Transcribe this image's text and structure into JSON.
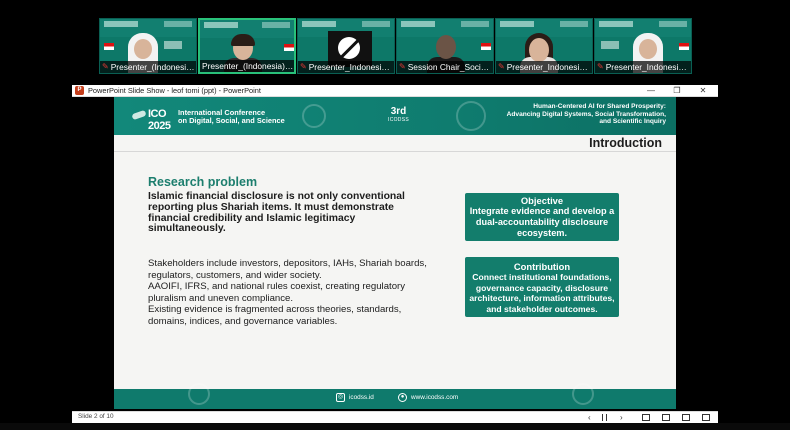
{
  "participants": [
    {
      "name": "Presenter_(Indonesia)_...",
      "kind": "hijab",
      "active": false
    },
    {
      "name": "Presenter_(Indonesia)_To...",
      "kind": "man",
      "active": true
    },
    {
      "name": "Presenter_Indonesia_F...",
      "kind": "off",
      "active": false
    },
    {
      "name": "Session Chair_Social 1...",
      "kind": "shadow",
      "active": false
    },
    {
      "name": "Presenter_Indonesia -...",
      "kind": "woman",
      "active": false
    },
    {
      "name": "Presenter_Indonesia_...",
      "kind": "hijab",
      "active": false
    }
  ],
  "window": {
    "title": "PowerPoint Slide Show  -  leof tomi (ppt)  -  PowerPoint",
    "minimize": "—",
    "restore": "❐",
    "close": "✕"
  },
  "slide": {
    "logo_text": "ICO 2025",
    "conference_line1": "International Conference",
    "conference_line2": "on Digital, Social, and Science",
    "edition_big": "3rd",
    "edition_small": "ICODSS",
    "theme_line1": "Human-Centered AI for Shared Prosperity:",
    "theme_line2": "Advancing Digital Systems, Social Transformation,",
    "theme_line3": "and Scientific Inquiry",
    "section_title": "Introduction",
    "research_problem_title": "Research problem",
    "research_problem_lead": "Islamic financial disclosure is not only conventional reporting plus Shariah items. It must demonstrate financial credibility and Islamic legitimacy simultaneously.",
    "body_p1": "Stakeholders include investors, depositors, IAHs, Shariah boards, regulators, customers, and wider society.",
    "body_p2": "AAOIFI, IFRS, and national rules coexist, creating regulatory pluralism and uneven compliance.",
    "body_p3": "Existing evidence is fragmented across theories, standards, domains, indices, and governance variables.",
    "objective_title": "Objective",
    "objective_text": "Integrate evidence and develop a dual-accountability disclosure ecosystem.",
    "contribution_title": "Contribution",
    "contribution_text": "Connect institutional foundations, governance capacity, disclosure architecture, information attributes, and stakeholder outcomes.",
    "footer_instagram": "icodss.id",
    "footer_web": "www.icodss.com"
  },
  "status": {
    "slide_counter": "Slide 2 of 10",
    "prev": "‹",
    "next": "›"
  },
  "colors": {
    "teal_header": "#12887a",
    "teal_card": "#137d6c",
    "title_green": "#1c7e6e",
    "active_tile_border": "#29c17a"
  }
}
